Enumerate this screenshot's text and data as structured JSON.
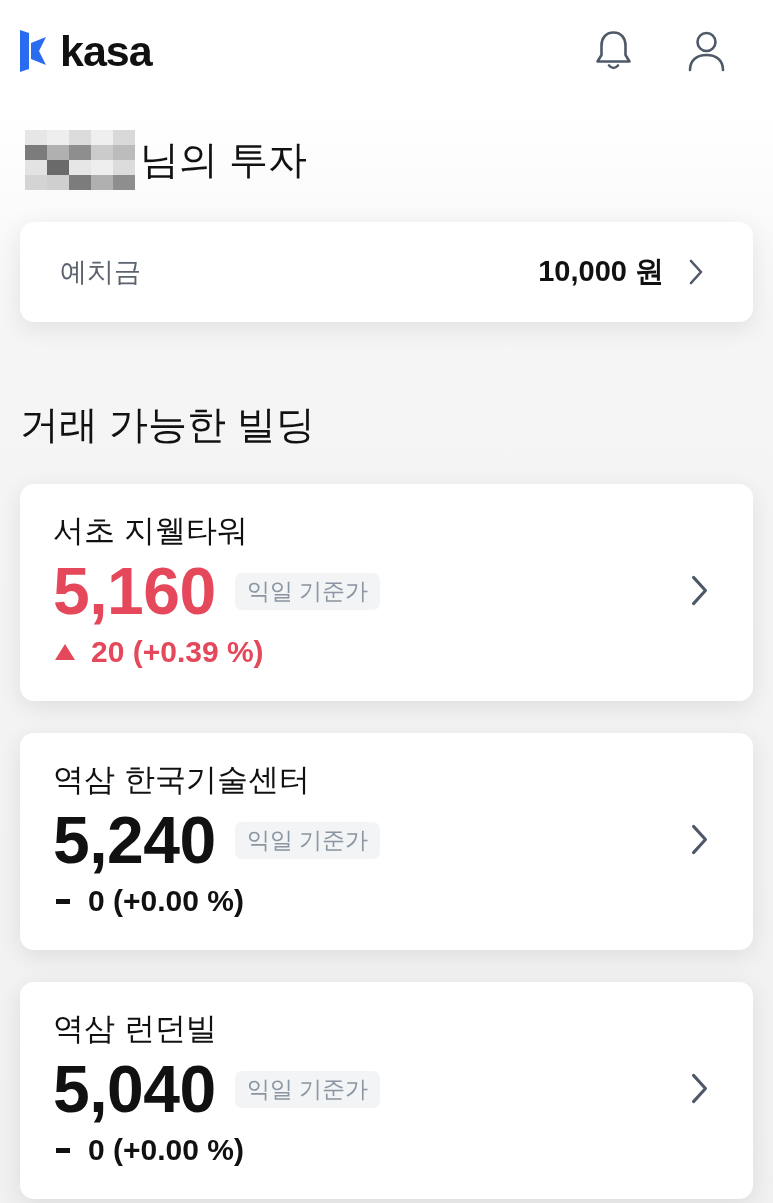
{
  "header": {
    "logo_text": "kasa"
  },
  "greeting": {
    "name_redacted": true,
    "text": "님의 투자"
  },
  "deposit": {
    "label": "예치금",
    "amount": "10,000 원"
  },
  "section_title": "거래 가능한 빌딩",
  "buildings": [
    {
      "name": "서초 지웰타워",
      "price": "5,160",
      "price_note": "익일 기준가",
      "change": {
        "kind": "up",
        "text": "20 (+0.39 %)"
      }
    },
    {
      "name": "역삼 한국기술센터",
      "price": "5,240",
      "price_note": "익일 기준가",
      "change": {
        "kind": "flat",
        "text": "0 (+0.00 %)"
      }
    },
    {
      "name": "역삼 런던빌",
      "price": "5,040",
      "price_note": "익일 기준가",
      "change": {
        "kind": "flat",
        "text": "0 (+0.00 %)"
      }
    }
  ]
}
